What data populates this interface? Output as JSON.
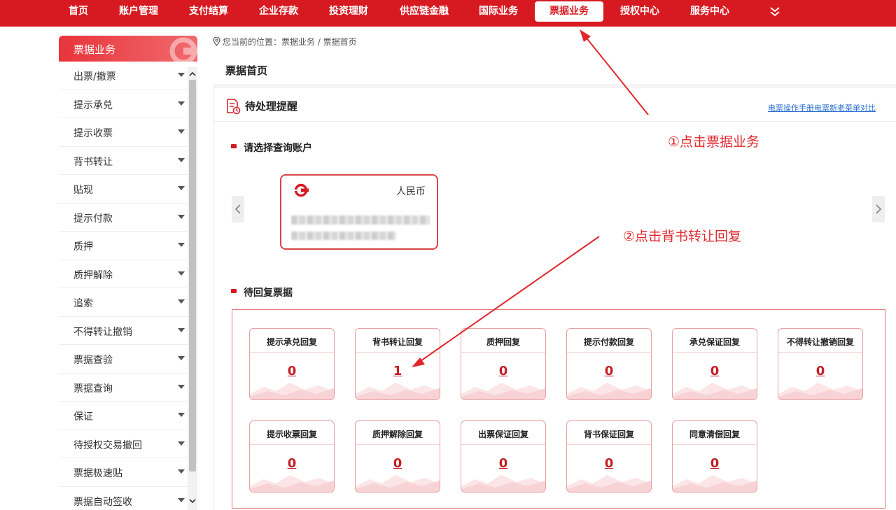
{
  "nav": {
    "items": [
      {
        "label": "首页"
      },
      {
        "label": "账户管理"
      },
      {
        "label": "支付结算"
      },
      {
        "label": "企业存款"
      },
      {
        "label": "投资理财"
      },
      {
        "label": "供应链金融"
      },
      {
        "label": "国际业务"
      },
      {
        "label": "票据业务",
        "active": true
      },
      {
        "label": "授权中心"
      },
      {
        "label": "服务中心"
      }
    ],
    "more_icon": "double-chevron-down-icon"
  },
  "sidebar": {
    "title": "票据业务",
    "items": [
      {
        "label": "出票/撤票"
      },
      {
        "label": "提示承兑"
      },
      {
        "label": "提示收票"
      },
      {
        "label": "背书转让"
      },
      {
        "label": "贴现"
      },
      {
        "label": "提示付款"
      },
      {
        "label": "质押"
      },
      {
        "label": "质押解除"
      },
      {
        "label": "追索"
      },
      {
        "label": "不得转让撤销"
      },
      {
        "label": "票据查验"
      },
      {
        "label": "票据查询"
      },
      {
        "label": "保证"
      },
      {
        "label": "待授权交易撤回"
      },
      {
        "label": "票据极速贴"
      },
      {
        "label": "票据自动签收"
      }
    ]
  },
  "breadcrumb": "您当前的位置：票据业务 / 票据首页",
  "page_title": "票据首页",
  "reminder": {
    "title": "待处理提醒",
    "link_manual": "电票操作手册",
    "link_compare": "电票新老菜单对比"
  },
  "account_section": {
    "title": "请选择查询账户",
    "card": {
      "currency": "人民币"
    }
  },
  "pending_section": {
    "title": "待回复票据",
    "tiles": [
      {
        "label": "提示承兑回复",
        "count": "0"
      },
      {
        "label": "背书转让回复",
        "count": "1"
      },
      {
        "label": "质押回复",
        "count": "0"
      },
      {
        "label": "提示付款回复",
        "count": "0"
      },
      {
        "label": "承兑保证回复",
        "count": "0"
      },
      {
        "label": "不得转让撤销回复",
        "count": "0"
      },
      {
        "label": "提示收票回复",
        "count": "0"
      },
      {
        "label": "质押解除回复",
        "count": "0"
      },
      {
        "label": "出票保证回复",
        "count": "0"
      },
      {
        "label": "背书保证回复",
        "count": "0"
      },
      {
        "label": "同意清偿回复",
        "count": "0"
      }
    ]
  },
  "annotations": {
    "step1": "①点击票据业务",
    "step2": "②点击背书转让回复"
  },
  "colors": {
    "brand_red": "#d71a21",
    "annotation_red": "#e0262c"
  }
}
